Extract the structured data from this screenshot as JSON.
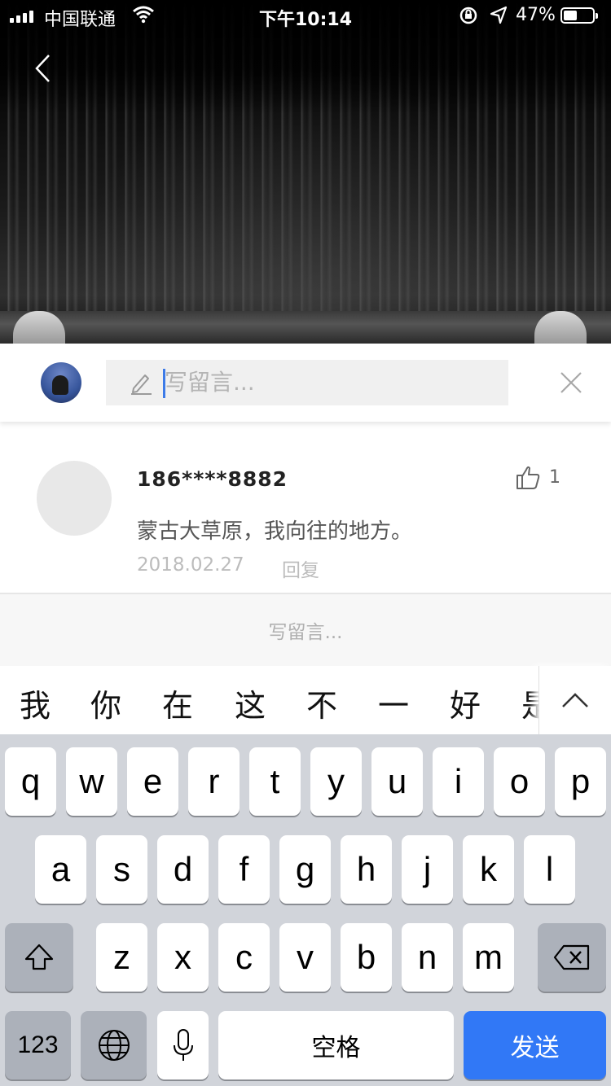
{
  "status_bar": {
    "carrier": "中国联通",
    "time": "下午10:14",
    "battery_percent": "47%",
    "battery_level": 0.47
  },
  "comment_bar": {
    "placeholder": "写留言..."
  },
  "comment": {
    "username": "186****8882",
    "text": "蒙古大草原，我向往的地方。",
    "date": "2018.02.27",
    "reply_label": "回复",
    "like_count": "1"
  },
  "write_prompt": "写留言...",
  "candidates": [
    "我",
    "你",
    "在",
    "这",
    "不",
    "一",
    "好"
  ],
  "candidate_partial": "是",
  "keyboard": {
    "row1": [
      "q",
      "w",
      "e",
      "r",
      "t",
      "y",
      "u",
      "i",
      "o",
      "p"
    ],
    "row2": [
      "a",
      "s",
      "d",
      "f",
      "g",
      "h",
      "j",
      "k",
      "l"
    ],
    "row3": [
      "z",
      "x",
      "c",
      "v",
      "b",
      "n",
      "m"
    ],
    "numbers_label": "123",
    "space_label": "空格",
    "send_label": "发送"
  },
  "icons": [
    "back-chevron-icon",
    "pencil-icon",
    "close-icon",
    "thumbs-up-icon",
    "shift-icon",
    "delete-icon",
    "globe-icon",
    "microphone-icon",
    "chevron-up-icon",
    "wifi-icon",
    "orientation-lock-icon",
    "location-arrow-icon",
    "battery-icon"
  ]
}
